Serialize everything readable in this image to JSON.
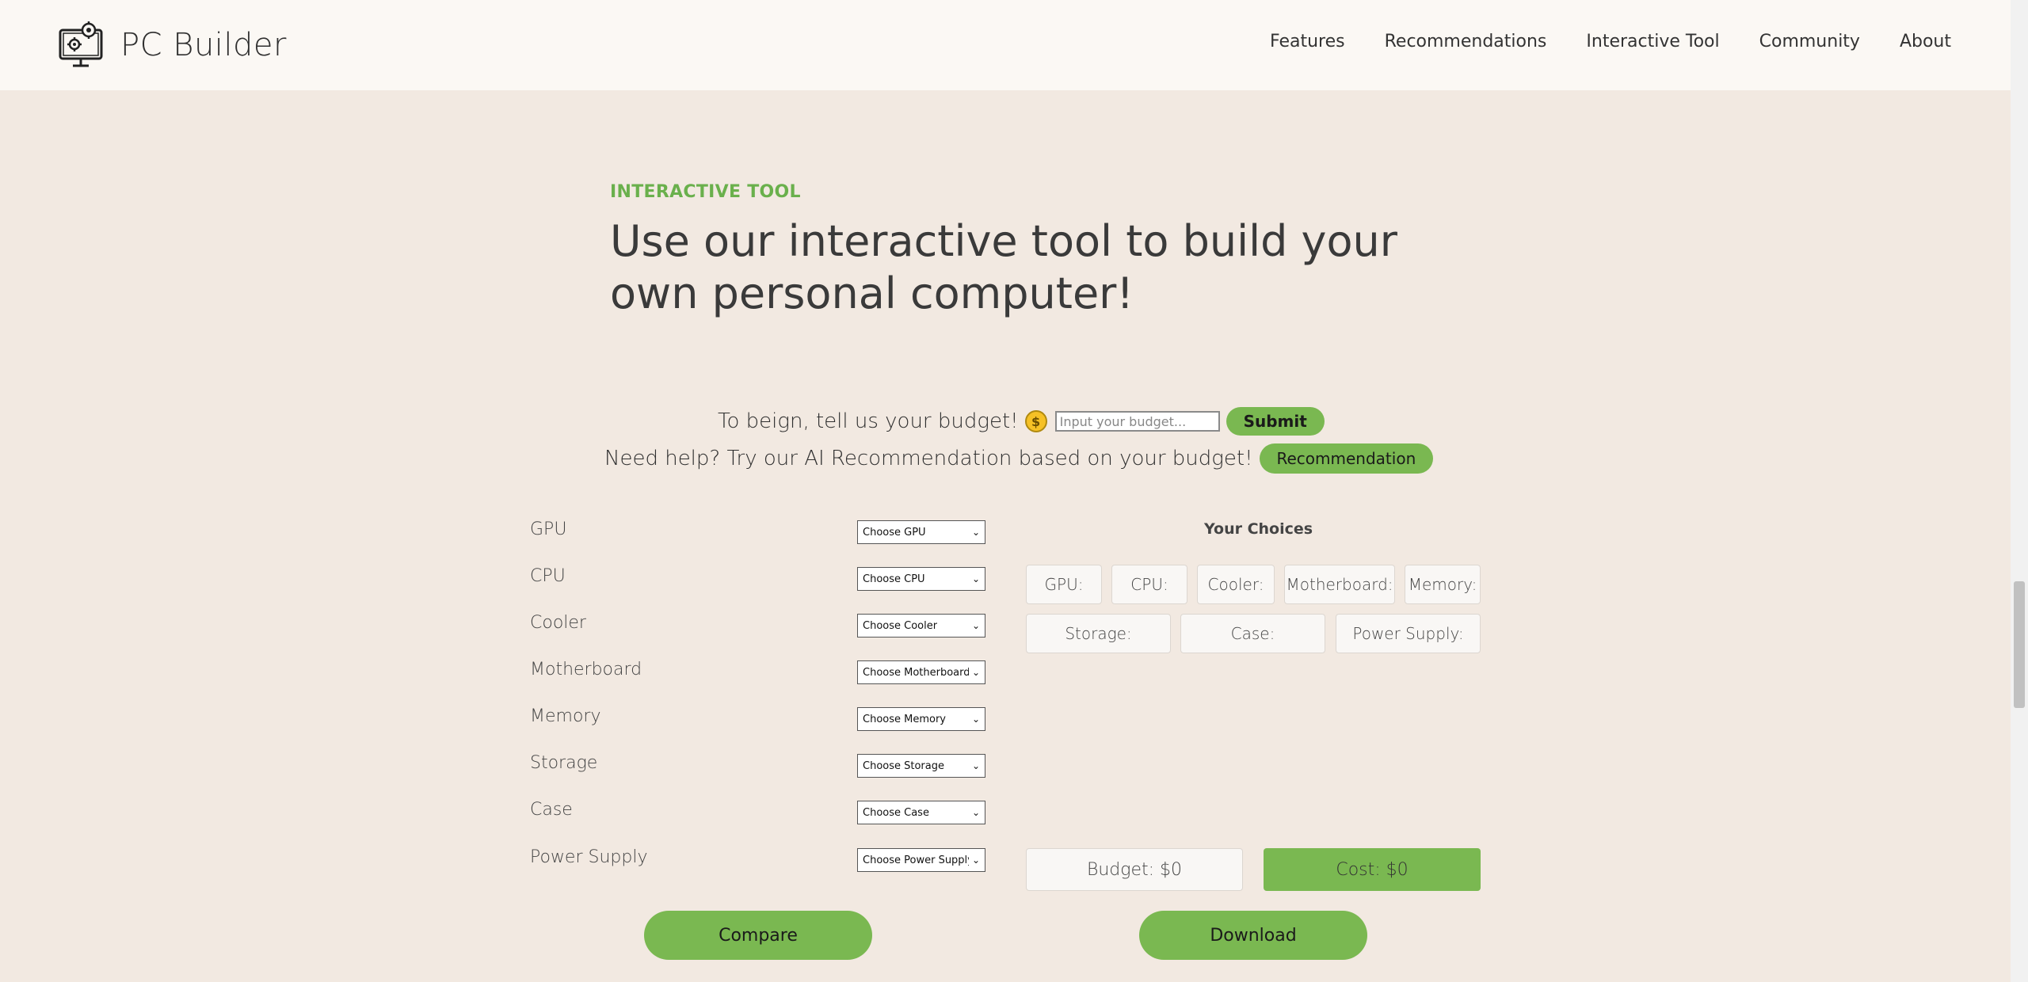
{
  "nav": {
    "brand": "PC Builder",
    "links": [
      "Features",
      "Recommendations",
      "Interactive Tool",
      "Community",
      "About"
    ]
  },
  "section": {
    "eyebrow": "INTERACTIVE TOOL",
    "heading": "Use our interactive tool to build your own personal computer!"
  },
  "budget": {
    "prompt": "To beign, tell us your budget!",
    "coin_icon": "money-bag-icon",
    "placeholder": "Input your budget...",
    "submit_label": "Submit"
  },
  "help": {
    "prompt": "Need help? Try our AI Recommendation based on your budget!",
    "button_label": "Recommendation"
  },
  "components": [
    {
      "label": "GPU",
      "select": "Choose GPU"
    },
    {
      "label": "CPU",
      "select": "Choose CPU"
    },
    {
      "label": "Cooler",
      "select": "Choose Cooler"
    },
    {
      "label": "Motherboard",
      "select": "Choose Motherboard"
    },
    {
      "label": "Memory",
      "select": "Choose Memory"
    },
    {
      "label": "Storage",
      "select": "Choose Storage"
    },
    {
      "label": "Case",
      "select": "Choose Case"
    },
    {
      "label": "Power Supply",
      "select": "Choose Power Supply"
    }
  ],
  "choices": {
    "title": "Your Choices",
    "row1": [
      "GPU:",
      "CPU:",
      "Cooler:",
      "Motherboard:",
      "Memory:"
    ],
    "row2": [
      "Storage:",
      "Case:",
      "Power Supply:"
    ]
  },
  "totals": {
    "budget": "Budget: $0",
    "cost": "Cost: $0"
  },
  "actions": {
    "compare": "Compare",
    "download": "Download"
  },
  "colors": {
    "accent": "#7ab851",
    "background": "#f2e9e1",
    "navbar": "#fbf8f4"
  }
}
